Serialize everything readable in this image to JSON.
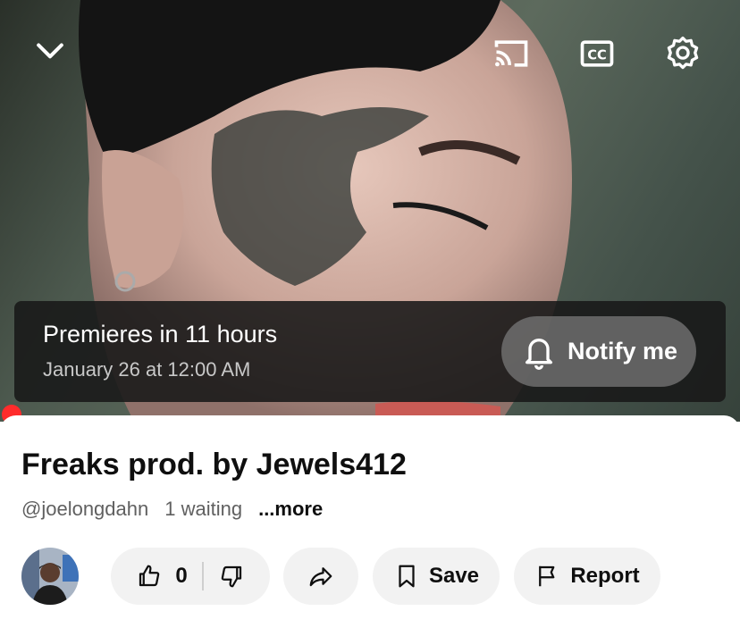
{
  "player": {
    "premiere_title": "Premieres in 11 hours",
    "premiere_date": "January 26 at 12:00 AM",
    "notify_label": "Notify me",
    "progress_color": "#ff2b2b"
  },
  "video": {
    "title": "Freaks prod. by Jewels412",
    "channel_handle": "@joelongdahn",
    "waiting_text": "1 waiting",
    "more_label": "...more"
  },
  "actions": {
    "like_count": "0",
    "save_label": "Save",
    "report_label": "Report"
  },
  "icons": [
    "chevron-down-icon",
    "cast-icon",
    "cc-icon",
    "gear-icon",
    "bell-icon",
    "thumbs-up-icon",
    "thumbs-down-icon",
    "share-icon",
    "bookmark-icon",
    "flag-icon"
  ]
}
